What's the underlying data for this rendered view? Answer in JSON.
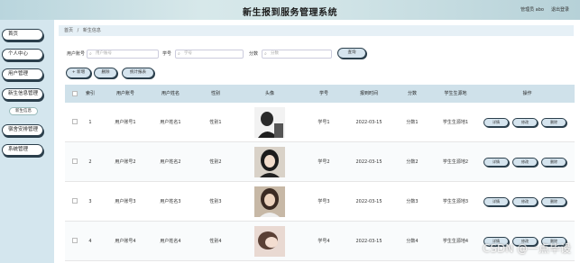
{
  "header": {
    "title": "新生报到服务管理系统",
    "role": "管理员 abo",
    "logout": "退出登录"
  },
  "sidebar": {
    "items": [
      {
        "label": "首页"
      },
      {
        "label": "个人中心"
      },
      {
        "label": "用户管理"
      },
      {
        "label": "新生信息管理"
      },
      {
        "label": "宿舍安排管理"
      },
      {
        "label": "系统管理"
      }
    ],
    "sub_item": "新生信息"
  },
  "breadcrumb": {
    "home": "首页",
    "sep": "/",
    "current": "新生信息"
  },
  "search": {
    "account_label": "用户账号",
    "account_placeholder": "用户账号",
    "id_label": "学号",
    "id_placeholder": "学号",
    "score_label": "分数",
    "score_placeholder": "分数",
    "button": "查询"
  },
  "actions": {
    "add": "+ 新增",
    "delete": "删除",
    "stats": "统计报表"
  },
  "table": {
    "columns": [
      "索引",
      "用户账号",
      "用户姓名",
      "性别",
      "头像",
      "学号",
      "报到时间",
      "分数",
      "学生生源地",
      "操作"
    ],
    "rows": [
      {
        "idx": "1",
        "account": "用户账号1",
        "name": "用户姓名1",
        "gender": "性别1",
        "sid": "学号1",
        "date": "2022-03-15",
        "score": "分数1",
        "origin": "学生生源地1"
      },
      {
        "idx": "2",
        "account": "用户账号2",
        "name": "用户姓名2",
        "gender": "性别2",
        "sid": "学号2",
        "date": "2022-03-15",
        "score": "分数2",
        "origin": "学生生源地2"
      },
      {
        "idx": "3",
        "account": "用户账号3",
        "name": "用户姓名3",
        "gender": "性别3",
        "sid": "学号3",
        "date": "2022-03-15",
        "score": "分数3",
        "origin": "学生生源地3"
      },
      {
        "idx": "4",
        "account": "用户账号4",
        "name": "用户姓名4",
        "gender": "性别4",
        "sid": "学号4",
        "date": "2022-03-15",
        "score": "分数4",
        "origin": "学生生源地4"
      }
    ],
    "row_actions": {
      "detail": "详情",
      "edit": "修改",
      "delete": "删除"
    }
  },
  "watermark": "CSDN @一点毕设",
  "colors": {
    "accent": "#2b3f4c",
    "header_bg": "#cfe1ea",
    "sidebar_bg": "#d4e6ee"
  }
}
